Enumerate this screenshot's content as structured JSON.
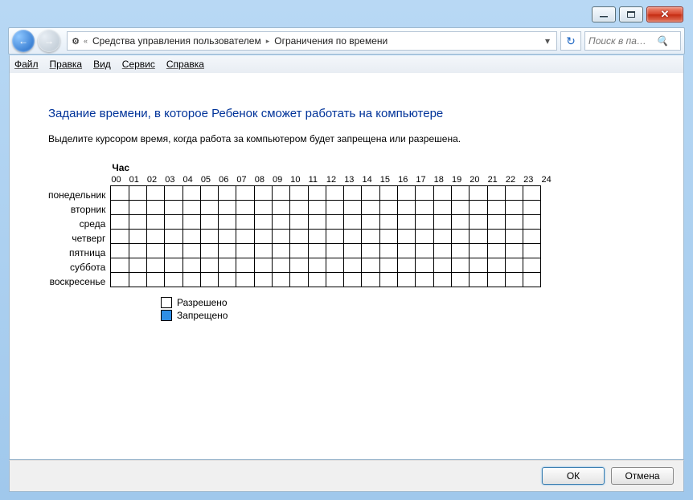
{
  "titlebar": {
    "min": "–",
    "max": "☐",
    "close": "✕"
  },
  "nav": {
    "back": "←",
    "fwd": "→",
    "chevrons": "«",
    "crumb1": "Средства управления пользователем",
    "crumb2": "Ограничения по времени",
    "sep": "▸",
    "refresh": "↻",
    "search_ph": "Поиск в па…"
  },
  "menu": {
    "file": "Файл",
    "edit": "Правка",
    "view": "Вид",
    "tools": "Сервис",
    "help": "Справка"
  },
  "page": {
    "heading": "Задание времени, в которое Ребенок сможет работать на компьютере",
    "instruction": "Выделите курсором время, когда работа за компьютером будет запрещена или разрешена.",
    "hour_label": "Час"
  },
  "days": [
    "понедельник",
    "вторник",
    "среда",
    "четверг",
    "пятница",
    "суббота",
    "воскресенье"
  ],
  "legend": {
    "allowed": "Разрешено",
    "blocked": "Запрещено"
  },
  "buttons": {
    "ok": "ОК",
    "cancel": "Отмена"
  },
  "chart_data": {
    "type": "heatmap",
    "title": "Задание времени, в которое Ребенок сможет работать на компьютере",
    "xlabel": "Час",
    "ylabel": "",
    "x": [
      "00",
      "01",
      "02",
      "03",
      "04",
      "05",
      "06",
      "07",
      "08",
      "09",
      "10",
      "11",
      "12",
      "13",
      "14",
      "15",
      "16",
      "17",
      "18",
      "19",
      "20",
      "21",
      "22",
      "23",
      "24"
    ],
    "categories": [
      "понедельник",
      "вторник",
      "среда",
      "четверг",
      "пятница",
      "суббота",
      "воскресенье"
    ],
    "legend": {
      "0": "Разрешено",
      "1": "Запрещено"
    },
    "values": [
      [
        0,
        0,
        0,
        0,
        0,
        0,
        0,
        0,
        0,
        0,
        0,
        0,
        0,
        0,
        0,
        0,
        0,
        0,
        0,
        0,
        0,
        0,
        0,
        0
      ],
      [
        0,
        0,
        0,
        0,
        0,
        0,
        0,
        0,
        0,
        0,
        0,
        0,
        0,
        0,
        0,
        0,
        0,
        0,
        0,
        0,
        0,
        0,
        0,
        0
      ],
      [
        0,
        0,
        0,
        0,
        0,
        0,
        0,
        0,
        0,
        0,
        0,
        0,
        0,
        0,
        0,
        0,
        0,
        0,
        0,
        0,
        0,
        0,
        0,
        0
      ],
      [
        0,
        0,
        0,
        0,
        0,
        0,
        0,
        0,
        0,
        0,
        0,
        0,
        0,
        0,
        0,
        0,
        0,
        0,
        0,
        0,
        0,
        0,
        0,
        0
      ],
      [
        0,
        0,
        0,
        0,
        0,
        0,
        0,
        0,
        0,
        0,
        0,
        0,
        0,
        0,
        0,
        0,
        0,
        0,
        0,
        0,
        0,
        0,
        0,
        0
      ],
      [
        0,
        0,
        0,
        0,
        0,
        0,
        0,
        0,
        0,
        0,
        0,
        0,
        0,
        0,
        0,
        0,
        0,
        0,
        0,
        0,
        0,
        0,
        0,
        0
      ],
      [
        0,
        0,
        0,
        0,
        0,
        0,
        0,
        0,
        0,
        0,
        0,
        0,
        0,
        0,
        0,
        0,
        0,
        0,
        0,
        0,
        0,
        0,
        0,
        0
      ]
    ]
  }
}
